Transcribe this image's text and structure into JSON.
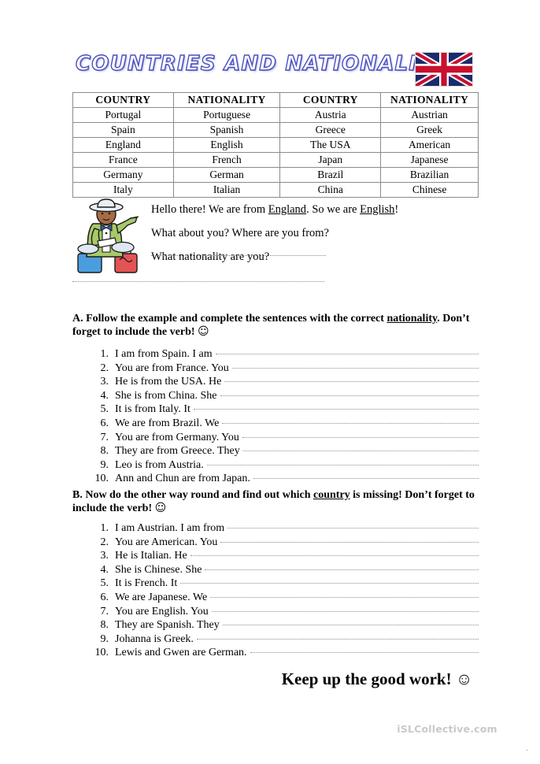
{
  "header": {
    "title": "COUNTRIES AND NATIONALITIES",
    "flag_name": "united-kingdom-flag"
  },
  "table": {
    "headers": [
      "COUNTRY",
      "NATIONALITY",
      "COUNTRY",
      "NATIONALITY"
    ],
    "rows": [
      [
        "Portugal",
        "Portuguese",
        "Austria",
        "Austrian"
      ],
      [
        "Spain",
        "Spanish",
        "Greece",
        "Greek"
      ],
      [
        "England",
        "English",
        "The USA",
        "American"
      ],
      [
        "France",
        "French",
        "Japan",
        "Japanese"
      ],
      [
        "Germany",
        "German",
        "Brazil",
        "Brazilian"
      ],
      [
        "Italy",
        "Italian",
        "China",
        "Chinese"
      ]
    ]
  },
  "dialogue": {
    "greeting_pre": "Hello there! We are from ",
    "greeting_country": "England",
    "greeting_mid": ". So we are ",
    "greeting_nationality": "English",
    "greeting_end": "!",
    "question_1": "What about you? Where are you from?",
    "question_2": "What nationality are you?"
  },
  "exercise_a": {
    "heading_pre": "A. Follow the example and complete the sentences with the correct ",
    "heading_underlined": "nationality",
    "heading_post": ". Don’t forget to include the verb! ",
    "smiley": "☺",
    "items": [
      {
        "num": "1.",
        "text": "I am from Spain. I am"
      },
      {
        "num": "2.",
        "text": "You are from France. You"
      },
      {
        "num": "3.",
        "text": "He is from the USA. He"
      },
      {
        "num": "4.",
        "text": "She is from China. She"
      },
      {
        "num": "5.",
        "text": "It is from Italy. It"
      },
      {
        "num": "6.",
        "text": "We are from Brazil. We"
      },
      {
        "num": "7.",
        "text": "You are from Germany. You"
      },
      {
        "num": "8.",
        "text": "They are from Greece. They"
      },
      {
        "num": "9.",
        "text": "Leo is from Austria."
      },
      {
        "num": "10.",
        "text": "Ann and Chun are from Japan."
      }
    ]
  },
  "exercise_b": {
    "heading_pre": "B. Now do the other way round and find out which ",
    "heading_underlined": "country",
    "heading_post": " is missing! Don’t forget to include the verb! ",
    "smiley": "☺",
    "items": [
      {
        "num": "1.",
        "text": "I am Austrian. I am from"
      },
      {
        "num": "2.",
        "text": "You are American. You"
      },
      {
        "num": "3.",
        "text": "He is Italian. He"
      },
      {
        "num": "4.",
        "text": "She is Chinese. She"
      },
      {
        "num": "5.",
        "text": "It is French. It"
      },
      {
        "num": "6.",
        "text": "We are Japanese. We"
      },
      {
        "num": "7.",
        "text": "You are English. You"
      },
      {
        "num": "8.",
        "text": "They are Spanish. They"
      },
      {
        "num": "9.",
        "text": "Johanna is Greek."
      },
      {
        "num": "10.",
        "text": "Lewis and Gwen are German."
      }
    ]
  },
  "footer": {
    "message": "Keep up the good work! ☺",
    "watermark": "iSLCollective.com",
    "page_mark": "."
  },
  "colors": {
    "title_stroke": "#4b4fbf",
    "table_border": "#8b8b8b",
    "dotted_line": "#8d8d8d",
    "watermark": "#c9c9c9",
    "flag_blue": "#1b2b6b",
    "flag_red": "#c8102e"
  }
}
